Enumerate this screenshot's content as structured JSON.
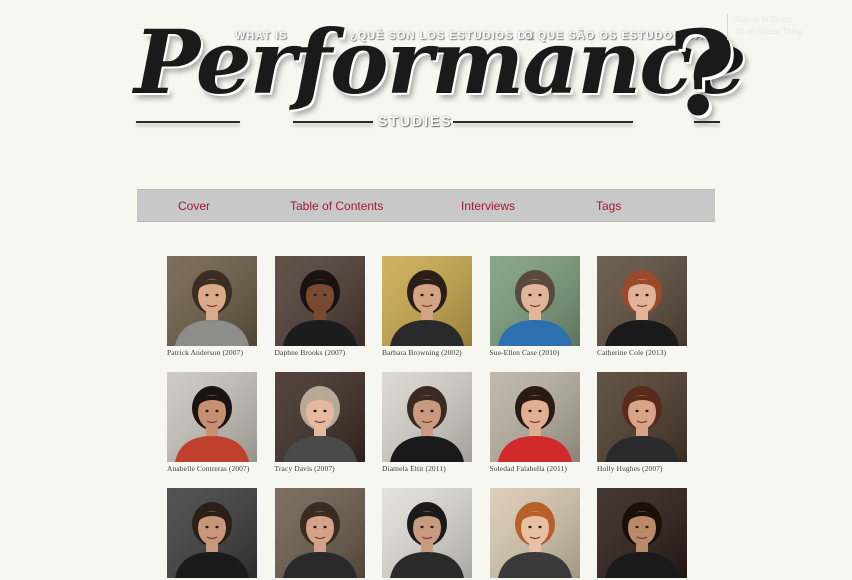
{
  "header": {
    "logo_word": "Performance",
    "logo_qmark": "?",
    "phrase_en": "WHAT IS",
    "phrase_es": "¿QUÉ SON LOS ESTUDIOS DE",
    "phrase_pt": "O QUE SÃO OS ESTUDOS DA",
    "subtitle": "STUDIES",
    "topright_line1": "Sign in to Scalar",
    "topright_line2": "Sit on Scalar Thing"
  },
  "nav": {
    "items": [
      {
        "label": "Cover"
      },
      {
        "label": "Table of Contents"
      },
      {
        "label": "Interviews"
      },
      {
        "label": "Tags"
      }
    ],
    "link_color": "#a31a36",
    "bar_color": "#c8c8c8"
  },
  "interviews": [
    {
      "name": "Patrick Anderson (2007)",
      "bg": "#6b5a44",
      "skin": "#d9a98b",
      "hair": "#3a2e24",
      "shirt": "#8d8d8a",
      "icon": "portrait-photo"
    },
    {
      "name": "Daphne Brooks (2007)",
      "bg": "#4a3a30",
      "skin": "#7a4a30",
      "hair": "#1a1210",
      "shirt": "#1c1c1c",
      "icon": "portrait-photo"
    },
    {
      "name": "Barbara Browning (2002)",
      "bg": "#c9a84a",
      "skin": "#d4a284",
      "hair": "#2a1e18",
      "shirt": "#2a2a2a",
      "icon": "portrait-photo"
    },
    {
      "name": "Sue-Ellen Case (2010)",
      "bg": "#7a9a7a",
      "skin": "#e0b59a",
      "hair": "#5a4a3e",
      "shirt": "#2e6fb0",
      "icon": "portrait-photo"
    },
    {
      "name": "Catherine Cole (2013)",
      "bg": "#5a4a3a",
      "skin": "#e2b398",
      "hair": "#9a4a2a",
      "shirt": "#1a1a1a",
      "icon": "portrait-photo"
    },
    {
      "name": "Anabelle Contreras (2007)",
      "bg": "#c8c4bc",
      "skin": "#c89072",
      "hair": "#1a1410",
      "shirt": "#c0402e",
      "icon": "portrait-photo"
    },
    {
      "name": "Tracy Davis (2007)",
      "bg": "#3a2a22",
      "skin": "#e4b9a0",
      "hair": "#b8a898",
      "shirt": "#4a4a4a",
      "icon": "portrait-photo"
    },
    {
      "name": "Diamela Eltit (2011)",
      "bg": "#d8d4cc",
      "skin": "#c99a80",
      "hair": "#3a2a22",
      "shirt": "#1a1a1a",
      "icon": "portrait-photo"
    },
    {
      "name": "Soledad Falabella (2011)",
      "bg": "#b8b0a0",
      "skin": "#e0ae90",
      "hair": "#2a1a14",
      "shirt": "#d02a2a",
      "icon": "portrait-photo"
    },
    {
      "name": "Holly Hughes (2007)",
      "bg": "#4a3a2a",
      "skin": "#d8a488",
      "hair": "#5a2a1a",
      "shirt": "#2a2a2a",
      "icon": "portrait-photo"
    },
    {
      "name": "",
      "bg": "#3a3a3a",
      "skin": "#c8967a",
      "hair": "#2a2018",
      "shirt": "#1a1a1a",
      "icon": "portrait-photo"
    },
    {
      "name": "",
      "bg": "#6a5a4a",
      "skin": "#d4a288",
      "hair": "#3a2a20",
      "shirt": "#2a2a2a",
      "icon": "portrait-photo"
    },
    {
      "name": "",
      "bg": "#e0ded8",
      "skin": "#c89a80",
      "hair": "#1a1a1a",
      "shirt": "#2a2a2a",
      "icon": "portrait-photo"
    },
    {
      "name": "",
      "bg": "#d8c8b0",
      "skin": "#e8c0a4",
      "hair": "#b8602a",
      "shirt": "#3a3a3a",
      "icon": "portrait-photo"
    },
    {
      "name": "",
      "bg": "#2a1a14",
      "skin": "#b88a6a",
      "hair": "#1a1008",
      "shirt": "#1a1a1a",
      "icon": "portrait-photo"
    }
  ]
}
